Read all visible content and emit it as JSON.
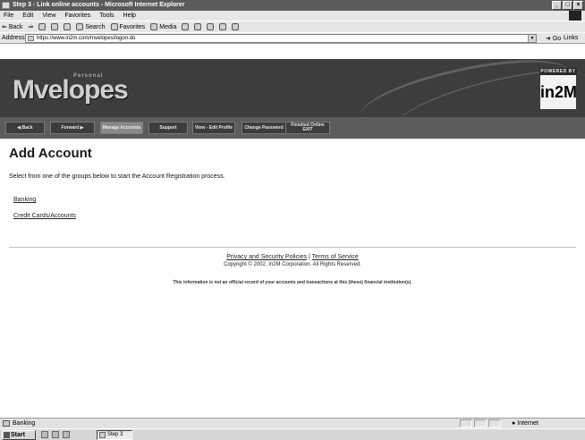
{
  "window": {
    "title": "Step 3 - Link online accounts - Microsoft Internet Explorer",
    "controls": [
      "_",
      "□",
      "×"
    ]
  },
  "menu": [
    "File",
    "Edit",
    "View",
    "Favorites",
    "Tools",
    "Help"
  ],
  "toolbar": {
    "back": "Back",
    "search": "Search",
    "favorites": "Favorites",
    "media": "Media"
  },
  "address": {
    "label": "Address",
    "url": "https://www.in2m.com/mvelopes/logon.do",
    "go": "Go",
    "links": "Links"
  },
  "banner": {
    "logo": "Mvelopes",
    "logo_sub": "Personal",
    "powered_by": "POWERED BY",
    "brand": "in2M"
  },
  "nav": {
    "back": "Back",
    "forward": "Forward",
    "manage_accounts": "Manage Accounts",
    "support": "Support",
    "view_edit_profile": "View - Edit Profile",
    "change_password": "Change Password",
    "finished_online_exit": "Finished Online EXIT"
  },
  "page": {
    "title": "Add Account",
    "intro": "Select from one of the groups below to start the Account Registration process.",
    "groups": [
      "Banking",
      "Credit Cards/Accounts"
    ]
  },
  "footer": {
    "privacy": "Privacy and Security Policies",
    "separator": "|",
    "terms": "Terms of Service",
    "copyright": "Copyright © 2002. In2M Corporation. All Rights Reserved.",
    "disclaimer": "This information is not an official record of your accounts and transactions at this (these) financial institution(s)."
  },
  "status": {
    "text": "Banking",
    "zone": "Internet"
  },
  "taskbar": {
    "start": "Start",
    "task": "Step 3"
  },
  "icons": [
    "ie-icon",
    "back-icon",
    "forward-icon",
    "stop-icon",
    "refresh-icon",
    "home-icon",
    "search-icon",
    "favorites-icon",
    "media-icon",
    "history-icon",
    "mail-icon",
    "print-icon",
    "edit-icon",
    "discuss-icon",
    "page-icon",
    "go-icon",
    "lock-icon",
    "globe-icon",
    "windows-logo-icon"
  ]
}
